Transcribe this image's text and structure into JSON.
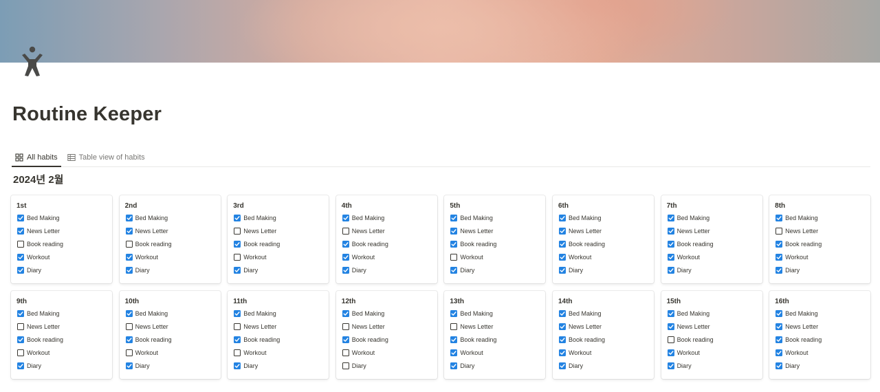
{
  "page": {
    "title": "Routine Keeper",
    "icon": "person-arms-up-icon"
  },
  "tabs": [
    {
      "label": "All habits",
      "icon": "gallery-grid-icon",
      "active": true
    },
    {
      "label": "Table view of habits",
      "icon": "table-icon",
      "active": false
    }
  ],
  "group_title": "2024년 2월",
  "colors": {
    "checkbox_on": "#2383e2",
    "text": "#37352f",
    "muted": "#787774"
  },
  "days": [
    {
      "title": "1st",
      "habits": [
        {
          "label": "Bed Making",
          "done": true
        },
        {
          "label": "News Letter",
          "done": true
        },
        {
          "label": "Book reading",
          "done": false
        },
        {
          "label": "Workout",
          "done": true
        },
        {
          "label": "Diary",
          "done": true
        }
      ]
    },
    {
      "title": "2nd",
      "habits": [
        {
          "label": "Bed Making",
          "done": true
        },
        {
          "label": "News Letter",
          "done": true
        },
        {
          "label": "Book reading",
          "done": false
        },
        {
          "label": "Workout",
          "done": true
        },
        {
          "label": "Diary",
          "done": true
        }
      ]
    },
    {
      "title": "3rd",
      "habits": [
        {
          "label": "Bed Making",
          "done": true
        },
        {
          "label": "News Letter",
          "done": false
        },
        {
          "label": "Book reading",
          "done": true
        },
        {
          "label": "Workout",
          "done": false
        },
        {
          "label": "Diary",
          "done": true
        }
      ]
    },
    {
      "title": "4th",
      "habits": [
        {
          "label": "Bed Making",
          "done": true
        },
        {
          "label": "News Letter",
          "done": false
        },
        {
          "label": "Book reading",
          "done": true
        },
        {
          "label": "Workout",
          "done": true
        },
        {
          "label": "Diary",
          "done": true
        }
      ]
    },
    {
      "title": "5th",
      "habits": [
        {
          "label": "Bed Making",
          "done": true
        },
        {
          "label": "News Letter",
          "done": true
        },
        {
          "label": "Book reading",
          "done": true
        },
        {
          "label": "Workout",
          "done": false
        },
        {
          "label": "Diary",
          "done": true
        }
      ]
    },
    {
      "title": "6th",
      "habits": [
        {
          "label": "Bed Making",
          "done": true
        },
        {
          "label": "News Letter",
          "done": true
        },
        {
          "label": "Book reading",
          "done": true
        },
        {
          "label": "Workout",
          "done": true
        },
        {
          "label": "Diary",
          "done": true
        }
      ]
    },
    {
      "title": "7th",
      "habits": [
        {
          "label": "Bed Making",
          "done": true
        },
        {
          "label": "News Letter",
          "done": true
        },
        {
          "label": "Book reading",
          "done": true
        },
        {
          "label": "Workout",
          "done": true
        },
        {
          "label": "Diary",
          "done": true
        }
      ]
    },
    {
      "title": "8th",
      "habits": [
        {
          "label": "Bed Making",
          "done": true
        },
        {
          "label": "News Letter",
          "done": false
        },
        {
          "label": "Book reading",
          "done": true
        },
        {
          "label": "Workout",
          "done": true
        },
        {
          "label": "Diary",
          "done": true
        }
      ]
    },
    {
      "title": "9th",
      "habits": [
        {
          "label": "Bed Making",
          "done": true
        },
        {
          "label": "News Letter",
          "done": false
        },
        {
          "label": "Book reading",
          "done": true
        },
        {
          "label": "Workout",
          "done": false
        },
        {
          "label": "Diary",
          "done": true
        }
      ]
    },
    {
      "title": "10th",
      "habits": [
        {
          "label": "Bed Making",
          "done": true
        },
        {
          "label": "News Letter",
          "done": false
        },
        {
          "label": "Book reading",
          "done": true
        },
        {
          "label": "Workout",
          "done": false
        },
        {
          "label": "Diary",
          "done": true
        }
      ]
    },
    {
      "title": "11th",
      "habits": [
        {
          "label": "Bed Making",
          "done": true
        },
        {
          "label": "News Letter",
          "done": false
        },
        {
          "label": "Book reading",
          "done": true
        },
        {
          "label": "Workout",
          "done": false
        },
        {
          "label": "Diary",
          "done": true
        }
      ]
    },
    {
      "title": "12th",
      "habits": [
        {
          "label": "Bed Making",
          "done": true
        },
        {
          "label": "News Letter",
          "done": false
        },
        {
          "label": "Book reading",
          "done": true
        },
        {
          "label": "Workout",
          "done": false
        },
        {
          "label": "Diary",
          "done": false
        }
      ]
    },
    {
      "title": "13th",
      "habits": [
        {
          "label": "Bed Making",
          "done": true
        },
        {
          "label": "News Letter",
          "done": false
        },
        {
          "label": "Book reading",
          "done": true
        },
        {
          "label": "Workout",
          "done": true
        },
        {
          "label": "Diary",
          "done": true
        }
      ]
    },
    {
      "title": "14th",
      "habits": [
        {
          "label": "Bed Making",
          "done": true
        },
        {
          "label": "News Letter",
          "done": true
        },
        {
          "label": "Book reading",
          "done": true
        },
        {
          "label": "Workout",
          "done": true
        },
        {
          "label": "Diary",
          "done": true
        }
      ]
    },
    {
      "title": "15th",
      "habits": [
        {
          "label": "Bed Making",
          "done": true
        },
        {
          "label": "News Letter",
          "done": true
        },
        {
          "label": "Book reading",
          "done": false
        },
        {
          "label": "Workout",
          "done": true
        },
        {
          "label": "Diary",
          "done": true
        }
      ]
    },
    {
      "title": "16th",
      "habits": [
        {
          "label": "Bed Making",
          "done": true
        },
        {
          "label": "News Letter",
          "done": true
        },
        {
          "label": "Book reading",
          "done": true
        },
        {
          "label": "Workout",
          "done": true
        },
        {
          "label": "Diary",
          "done": true
        }
      ]
    }
  ]
}
